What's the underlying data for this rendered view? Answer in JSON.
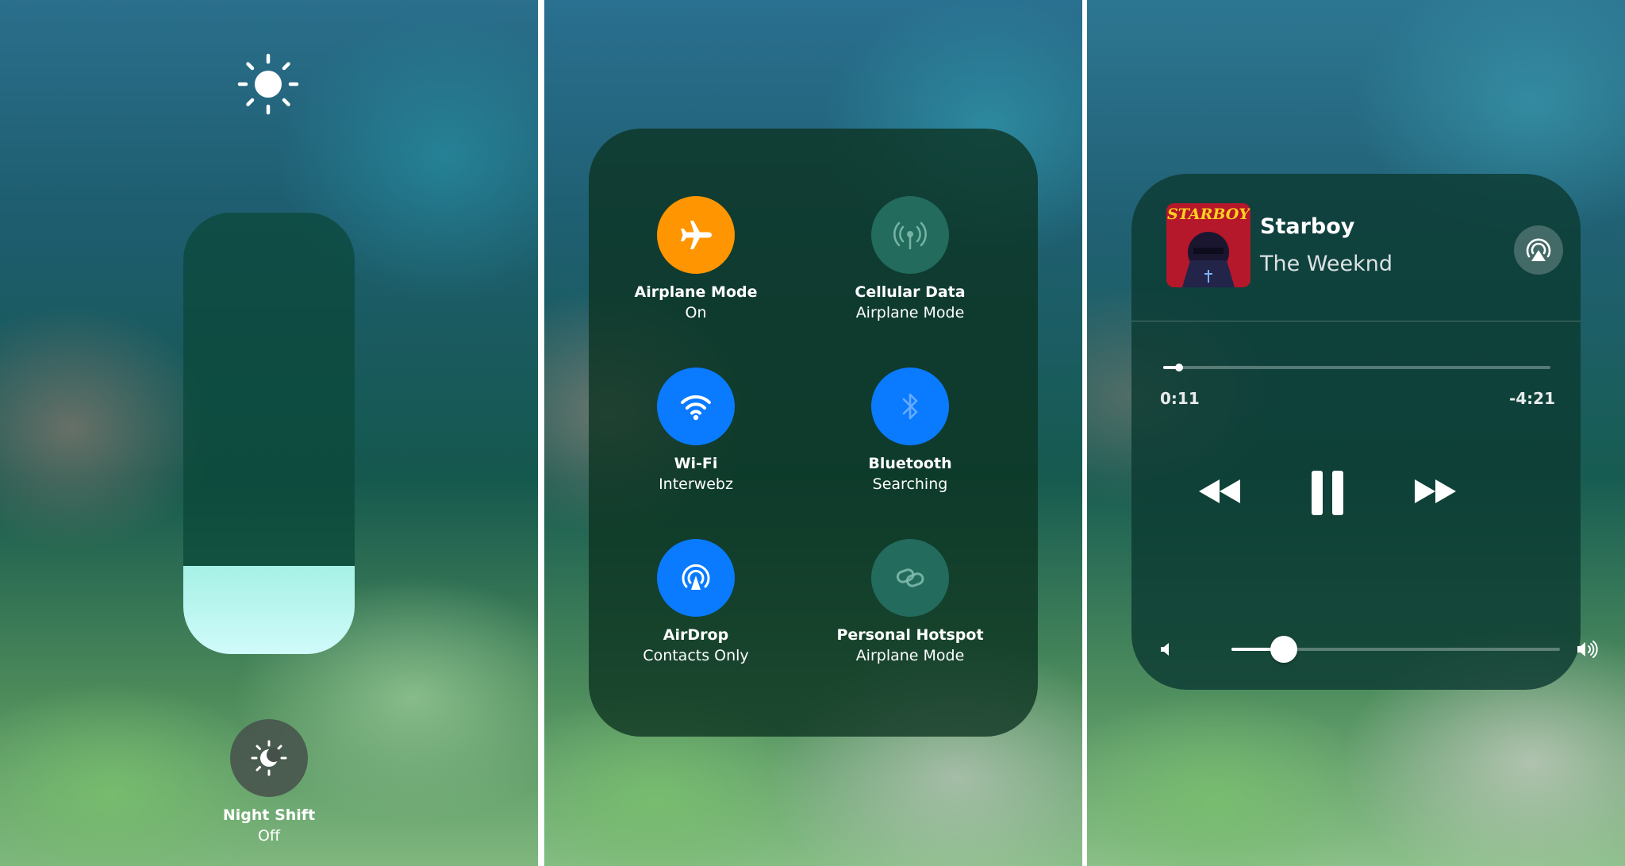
{
  "brightness_panel": {
    "top_icon": "sun-icon",
    "brightness_level": 0.2,
    "night_shift": {
      "icon": "night-shift-icon",
      "label": "Night Shift",
      "state": "Off"
    }
  },
  "connectivity_panel": {
    "toggles": [
      {
        "label": "Airplane Mode",
        "sub": "On",
        "icon": "airplane-icon",
        "color": "#ff9500"
      },
      {
        "label": "Cellular Data",
        "sub": "Airplane Mode",
        "icon": "cellular-antenna-icon",
        "color": "#246e60"
      },
      {
        "label": "Wi-Fi",
        "sub": "Interwebz",
        "icon": "wifi-icon",
        "color": "#0a7aff"
      },
      {
        "label": "Bluetooth",
        "sub": "Searching",
        "icon": "bluetooth-icon",
        "color": "#0a7aff"
      },
      {
        "label": "AirDrop",
        "sub": "Contacts Only",
        "icon": "airdrop-icon",
        "color": "#0a7aff"
      },
      {
        "label": "Personal Hotspot",
        "sub": "Airplane Mode",
        "icon": "hotspot-link-icon",
        "color": "#246e60"
      }
    ]
  },
  "music_panel": {
    "album_art_text": "STARBOY",
    "title": "Starboy",
    "artist": "The Weeknd",
    "airplay_icon": "airplay-icon",
    "elapsed": "0:11",
    "remaining": "-4:21",
    "progress": 0.04,
    "volume": 0.16,
    "controls": [
      "rewind-icon",
      "pause-icon",
      "fast-forward-icon"
    ],
    "volume_icons": [
      "volume-low-icon",
      "volume-high-icon"
    ]
  }
}
